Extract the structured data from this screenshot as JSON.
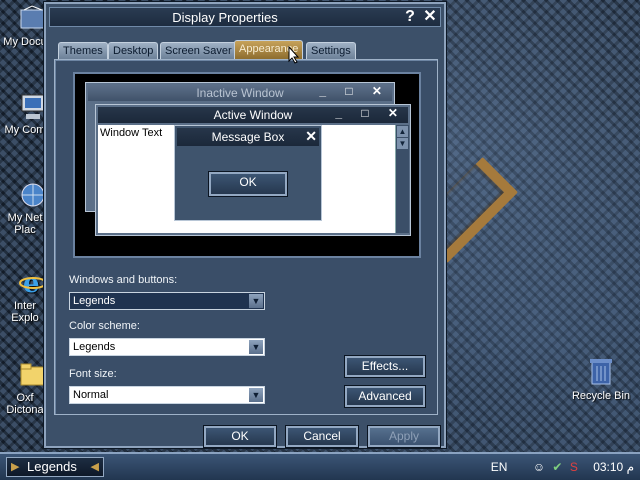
{
  "desktop": {
    "icons": [
      {
        "label": "My Docu"
      },
      {
        "label": "My Com"
      },
      {
        "label": "My Net Plac"
      },
      {
        "label": "Inter Explo"
      },
      {
        "label": "Oxf Dictona"
      }
    ],
    "recycle_bin": "Recycle Bin"
  },
  "dialog": {
    "title": "Display Properties",
    "help_glyph": "?",
    "close_glyph": "✕",
    "tabs": [
      {
        "label": "Themes"
      },
      {
        "label": "Desktop"
      },
      {
        "label": "Screen Saver"
      },
      {
        "label": "Appearance"
      },
      {
        "label": "Settings"
      }
    ],
    "active_tab": "Appearance",
    "preview": {
      "inactive_title": "Inactive Window",
      "active_title": "Active Window",
      "window_text": "Window Text",
      "message_title": "Message Box",
      "message_ok": "OK",
      "title_buttons": "_ □ ✕"
    },
    "windows_buttons": {
      "label": "Windows and buttons:",
      "value": "Legends"
    },
    "color_scheme": {
      "label": "Color scheme:",
      "value": "Legends"
    },
    "font_size": {
      "label": "Font size:",
      "value": "Normal"
    },
    "effects_label": "Effects...",
    "advanced_label": "Advanced",
    "ok_label": "OK",
    "cancel_label": "Cancel",
    "apply_label": "Apply"
  },
  "taskbar": {
    "start_label": "Legends",
    "language": "EN",
    "clock": "03:10 م"
  }
}
